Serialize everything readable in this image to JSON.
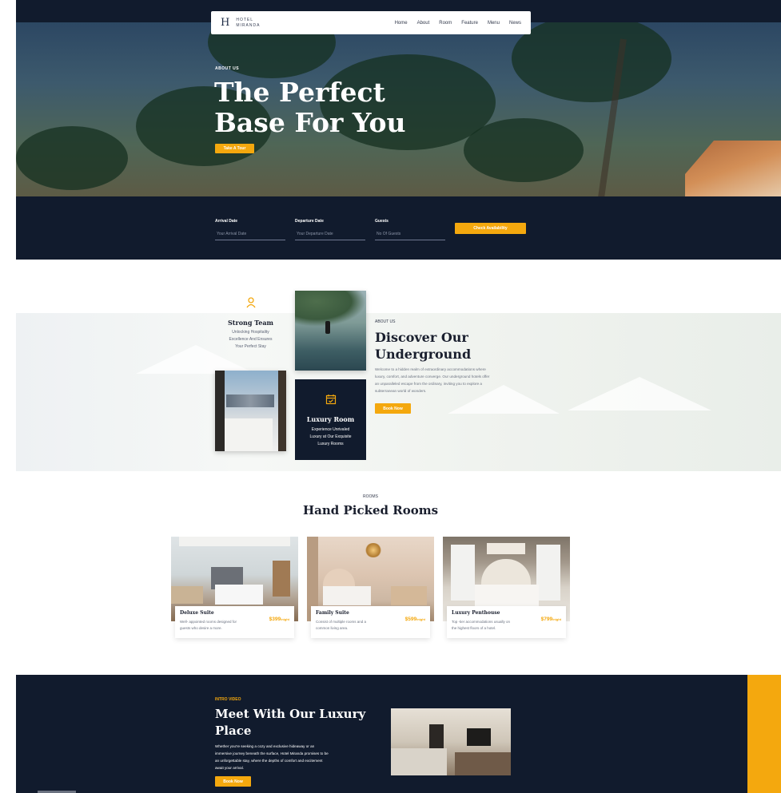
{
  "header": {
    "logo_letter": "H",
    "logo_line1": "HOTEL",
    "logo_line2": "MIRANDA",
    "nav": [
      "Home",
      "About",
      "Room",
      "Feature",
      "Menu",
      "News"
    ]
  },
  "hero": {
    "eyebrow": "ABOUT US",
    "title_line1": "The Perfect",
    "title_line2": "Base For You",
    "cta": "Take A Tour"
  },
  "booking": {
    "arrival_label": "Arrival Date",
    "arrival_placeholder": "Your Arrival Date",
    "departure_label": "Departure Date",
    "departure_placeholder": "Your Departure Date",
    "guests_label": "Guests",
    "guests_placeholder": "No Of Guests",
    "submit": "Check Availability"
  },
  "about": {
    "team_title": "Strong Team",
    "team_text_1": "Unlocking Hospitality",
    "team_text_2": "Excellence And Ensures",
    "team_text_3": "Your Perfect Stay",
    "luxury_title": "Luxury Room",
    "luxury_text_1": "Experience Unrivaled",
    "luxury_text_2": "Luxury at Our Exquisite",
    "luxury_text_3": "Luxury Rooms",
    "eyebrow": "ABOUT US",
    "title_line1": "Discover Our",
    "title_line2": "Underground",
    "body_1": "Welcome to a hidden realm of extraordinary accommodations where",
    "body_2": "luxury, comfort, and adventure converge. Our underground hotels offer",
    "body_3": "an unparalleled escape from the ordinary, inviting you to explore a",
    "body_4": "subterranean world of wonders.",
    "cta": "Book Now"
  },
  "rooms": {
    "eyebrow": "ROOMS",
    "title": "Hand Picked Rooms",
    "items": [
      {
        "name": "Deluxe Suite",
        "desc_1": "Well- appointed rooms designed for",
        "desc_2": "guests who desire a more.",
        "price": "$399",
        "unit": "/night"
      },
      {
        "name": "Family Suite",
        "desc_1": "Consist of multiple rooms and a",
        "desc_2": "common living area.",
        "price": "$599",
        "unit": "/night"
      },
      {
        "name": "Luxury Penthouse",
        "desc_1": "Top -tier accommodations usually on",
        "desc_2": "the highest floors of a hotel.",
        "price": "$799",
        "unit": "/night"
      }
    ]
  },
  "intro": {
    "eyebrow": "INTRO VIDEO",
    "title_line1": "Meet With Our Luxury",
    "title_line2": "Place",
    "body_1": "Whether you're seeking a cozy and exclusive hideaway or an",
    "body_2": "immersive journey beneath the surface, Hotel Miranda promises to be",
    "body_3": "an unforgettable stay, where the depths of comfort and excitement",
    "body_4": "await your arrival.",
    "cta": "Book Now"
  },
  "colors": {
    "navy": "#111b2d",
    "accent": "#f4a80e"
  }
}
